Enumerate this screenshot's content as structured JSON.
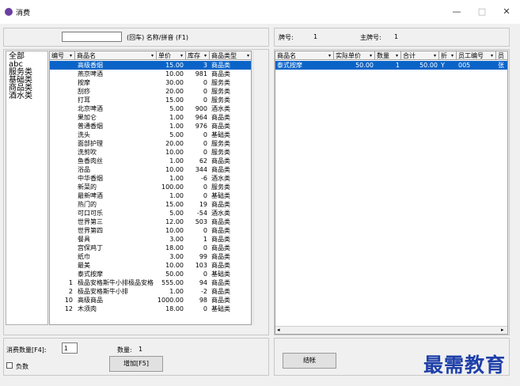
{
  "window": {
    "title": "消费",
    "minimize": "—",
    "maximize": "□",
    "close": "✕"
  },
  "search": {
    "value": "",
    "hint": "(回车) 名称/拼音 (F1)"
  },
  "categories": [
    "全部",
    "abc",
    "服务类",
    "基础类",
    "商品类",
    "酒水类"
  ],
  "product_grid": {
    "columns": [
      "编号",
      "商品名",
      "单价",
      "库存",
      "商品类型"
    ],
    "rows": [
      [
        "",
        "高级香烟",
        "15.00",
        "3",
        "商品类"
      ],
      [
        "",
        "燕京啤酒",
        "10.00",
        "981",
        "商品类"
      ],
      [
        "",
        "按摩",
        "30.00",
        "0",
        "服务类"
      ],
      [
        "",
        "刮痧",
        "20.00",
        "0",
        "服务类"
      ],
      [
        "",
        "打耳",
        "15.00",
        "0",
        "服务类"
      ],
      [
        "",
        "北京啤酒",
        "5.00",
        "900",
        "酒水类"
      ],
      [
        "",
        "果加仑",
        "1.00",
        "964",
        "商品类"
      ],
      [
        "",
        "普通香烟",
        "1.00",
        "976",
        "商品类"
      ],
      [
        "",
        "洗头",
        "5.00",
        "0",
        "基础类"
      ],
      [
        "",
        "面部护理",
        "20.00",
        "0",
        "服务类"
      ],
      [
        "",
        "洗剪吹",
        "10.00",
        "0",
        "服务类"
      ],
      [
        "",
        "鱼香肉丝",
        "1.00",
        "62",
        "商品类"
      ],
      [
        "",
        "浴品",
        "10.00",
        "344",
        "商品类"
      ],
      [
        "",
        "中华香烟",
        "1.00",
        "-6",
        "酒水类"
      ],
      [
        "",
        "新菜的",
        "100.00",
        "0",
        "服务类"
      ],
      [
        "",
        "最新啤酒",
        "1.00",
        "0",
        "基础类"
      ],
      [
        "",
        "热门的",
        "15.00",
        "19",
        "商品类"
      ],
      [
        "",
        "可口可乐",
        "5.00",
        "-54",
        "酒水类"
      ],
      [
        "",
        "世界第三",
        "12.00",
        "503",
        "商品类"
      ],
      [
        "",
        "世界第四",
        "10.00",
        "0",
        "商品类"
      ],
      [
        "",
        "餐具",
        "3.00",
        "1",
        "商品类"
      ],
      [
        "",
        "宫保鸡丁",
        "18.00",
        "0",
        "商品类"
      ],
      [
        "",
        "纸巾",
        "3.00",
        "99",
        "商品类"
      ],
      [
        "",
        "最美",
        "10.00",
        "103",
        "商品类"
      ],
      [
        "",
        "泰式按摩",
        "50.00",
        "0",
        "基础类"
      ],
      [
        "1",
        "极品安格斯牛小排极品安格",
        "555.00",
        "94",
        "商品类"
      ],
      [
        "2",
        "极品安格斯牛小排",
        "1.00",
        "-2",
        "商品类"
      ],
      [
        "10",
        "高级商品",
        "1000.00",
        "98",
        "商品类"
      ],
      [
        "12",
        "木须肉",
        "18.00",
        "0",
        "基础类"
      ]
    ]
  },
  "order_info": {
    "plate_label": "牌号:",
    "plate_value": "1",
    "main_plate_label": "主牌号:",
    "main_plate_value": "1"
  },
  "order_grid": {
    "columns": [
      "商品名",
      "实际单价",
      "数量",
      "合计",
      "折",
      "员工编号",
      "员"
    ],
    "rows": [
      [
        "泰式按摩",
        "50.00",
        "1",
        "50.00",
        "Y",
        "005",
        "张"
      ]
    ]
  },
  "footer": {
    "qty_label": "消费数量[F4]:",
    "qty_value": "1",
    "count_label": "数量:",
    "count_value": "1",
    "negative_label": "负数",
    "add_button": "增加[F5]",
    "checkout_button": "结帐"
  },
  "watermark": "最需教育",
  "colors": {
    "selection": "#0a64c8",
    "watermark": "#1e3fa8",
    "icon": "#6b3fa0"
  }
}
